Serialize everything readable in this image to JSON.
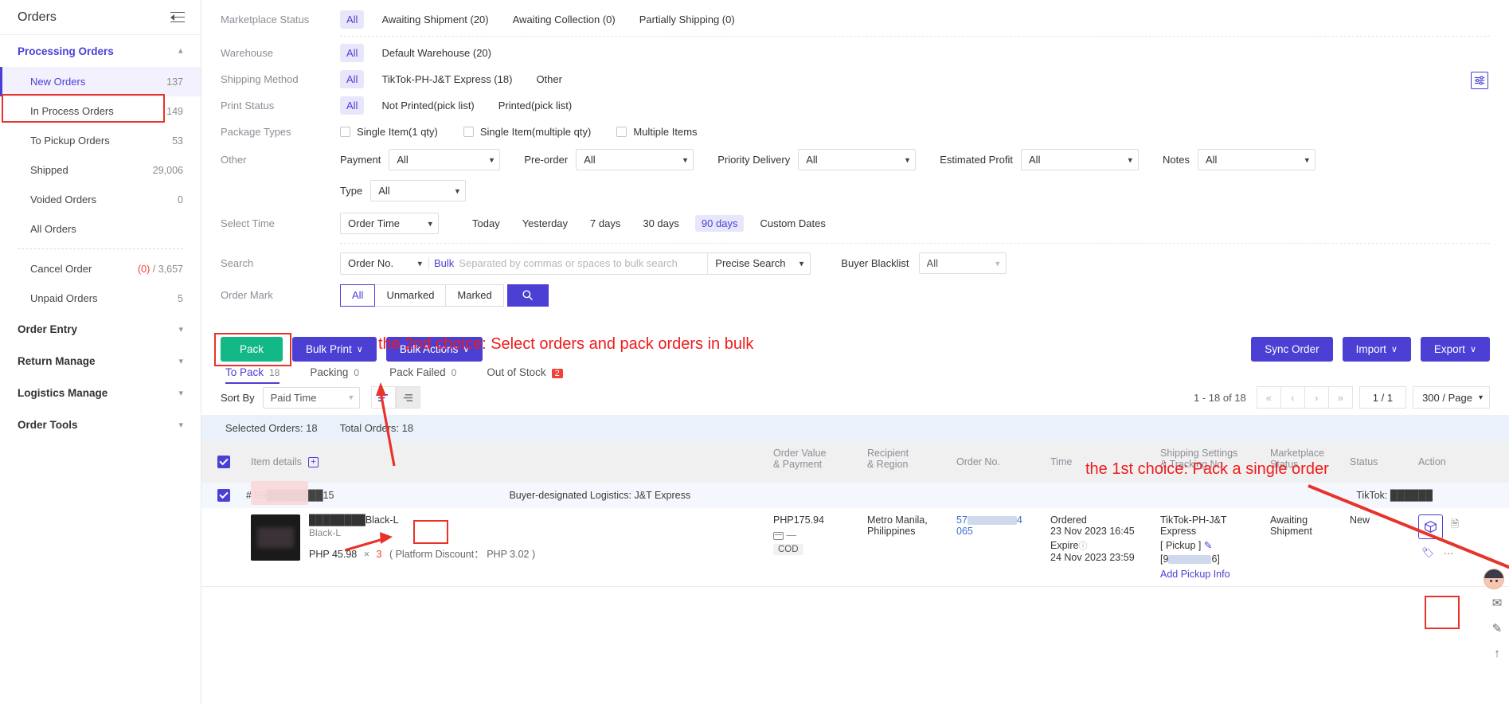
{
  "sidebar": {
    "title": "Orders",
    "collapse_icon": "collapse-icon",
    "groups": [
      {
        "label": "Processing Orders",
        "expanded": true,
        "items": [
          {
            "label": "New Orders",
            "count": "137",
            "active": true
          },
          {
            "label": "In Process Orders",
            "count": "149"
          },
          {
            "label": "To Pickup Orders",
            "count": "53"
          },
          {
            "label": "Shipped",
            "count": "29,006"
          },
          {
            "label": "Voided Orders",
            "count": "0"
          },
          {
            "label": "All Orders",
            "count": ""
          }
        ],
        "items2": [
          {
            "label": "Cancel Order",
            "count_red": "(0)",
            "count": " / 3,657"
          },
          {
            "label": "Unpaid Orders",
            "count": "5"
          }
        ]
      },
      {
        "label": "Order Entry",
        "expanded": false
      },
      {
        "label": "Return Manage",
        "expanded": false
      },
      {
        "label": "Logistics Manage",
        "expanded": false
      },
      {
        "label": "Order Tools",
        "expanded": false
      }
    ]
  },
  "filters": {
    "marketplace_status": {
      "label": "Marketplace Status",
      "options": [
        "All",
        "Awaiting Shipment (20)",
        "Awaiting Collection (0)",
        "Partially Shipping (0)"
      ],
      "selected": "All"
    },
    "warehouse": {
      "label": "Warehouse",
      "options": [
        "All",
        "Default Warehouse (20)"
      ],
      "selected": "All"
    },
    "shipping_method": {
      "label": "Shipping Method",
      "options": [
        "All",
        "TikTok-PH-J&T Express (18)",
        "Other"
      ],
      "selected": "All"
    },
    "print_status": {
      "label": "Print Status",
      "options": [
        "All",
        "Not Printed(pick list)",
        "Printed(pick list)"
      ],
      "selected": "All"
    },
    "package_types": {
      "label": "Package Types",
      "options": [
        "Single Item(1 qty)",
        "Single Item(multiple qty)",
        "Multiple Items"
      ]
    },
    "other": {
      "label": "Other",
      "fields": [
        {
          "label": "Payment",
          "value": "All"
        },
        {
          "label": "Pre-order",
          "value": "All"
        },
        {
          "label": "Priority Delivery",
          "value": "All"
        },
        {
          "label": "Estimated Profit",
          "value": "All"
        },
        {
          "label": "Notes",
          "value": "All"
        }
      ],
      "type_field": {
        "label": "Type",
        "value": "All"
      }
    },
    "select_time": {
      "label": "Select Time",
      "dropdown": "Order Time",
      "buttons": [
        "Today",
        "Yesterday",
        "7 days",
        "30 days",
        "90 days",
        "Custom Dates"
      ],
      "selected": "90 days"
    },
    "search": {
      "label": "Search",
      "field_type": "Order No.",
      "bulk_label": "Bulk",
      "placeholder": "Separated by commas or spaces to bulk search",
      "value": "",
      "match_mode": "Precise Search",
      "blacklist_label": "Buyer Blacklist",
      "blacklist_value": "All"
    },
    "order_mark": {
      "label": "Order Mark",
      "options": [
        "All",
        "Unmarked",
        "Marked"
      ],
      "selected": "All",
      "search_icon": "search-icon"
    },
    "config_icon": "column-config-icon"
  },
  "toolbar": {
    "pack": "Pack",
    "bulk_print": "Bulk Print",
    "bulk_actions": "Bulk Actions",
    "sync_order": "Sync Order",
    "import": "Import",
    "export": "Export",
    "chevron": "∨"
  },
  "tabs": [
    {
      "label": "To Pack",
      "count": "18",
      "active": true
    },
    {
      "label": "Packing",
      "count": "0"
    },
    {
      "label": "Pack Failed",
      "count": "0"
    },
    {
      "label": "Out of Stock",
      "count": "2",
      "badge": true
    }
  ],
  "sortbar": {
    "label": "Sort By",
    "value": "Paid Time",
    "asc_icon": "sort-ascending-icon",
    "desc_icon": "sort-descending-icon",
    "range": "1 - 18 of 18",
    "first": "«",
    "prev": "‹",
    "next": "›",
    "last": "»",
    "page": "1 / 1",
    "page_size": "300 / Page"
  },
  "selection_bar": {
    "selected": "Selected Orders: 18",
    "total": "Total Orders: 18"
  },
  "table": {
    "headers": {
      "item_details": "Item details",
      "expand_icon": "expand-all-icon",
      "order_value": "Order Value\n& Payment",
      "order_value_l1": "Order Value",
      "order_value_l2": "& Payment",
      "recipient_l1": "Recipient",
      "recipient_l2": "& Region",
      "order_no": "Order No.",
      "time": "Time",
      "shipping_l1": "Shipping Settings",
      "shipping_l2": "& Tracking No.",
      "marketplace_l1": "Marketplace",
      "marketplace_l2": "Status",
      "status": "Status",
      "action": "Action"
    },
    "rows": [
      {
        "order_ref": "# B9████████15",
        "logistics": "Buyer-designated Logistics: J&T Express",
        "marketplace_account": "TikTok: ██████",
        "product_name": "████████Black-L",
        "product_meta": "Black-L",
        "unit_price": "PHP 45.98",
        "qty": "3",
        "discount_label": "( Platform Discount：",
        "discount_value": "PHP 3.02 )",
        "order_value": "PHP175.94",
        "payment_icon": "card-icon",
        "payment_dash": "—",
        "payment_tag": "COD",
        "recipient_l1": "Metro Manila,",
        "recipient_l2": "Philippines",
        "order_no_prefix": "57",
        "order_no_suffix": "4",
        "order_no_line2": "065",
        "time_status": "Ordered",
        "time_value": "23 Nov 2023 16:45",
        "expire_label": "Expire",
        "expire_icon": "help-icon",
        "expire_value": "24 Nov 2023 23:59",
        "ship_l1": "TikTok-PH-J&T",
        "ship_l2": "Express",
        "pickup_label": "[ Pickup ]",
        "edit_icon": "edit-icon",
        "tracking": "[9███████6]",
        "add_pickup": "Add Pickup Info",
        "marketplace_l1": "Awaiting",
        "marketplace_l2": "Shipment",
        "status": "New",
        "action_icon": "package-box-icon",
        "action_icons": [
          "note-icon",
          "tag-icon",
          "more-icon"
        ]
      }
    ]
  },
  "annotations": [
    {
      "id": "anno-bulk",
      "text": "the 2nd choice: Select orders and pack orders in bulk"
    },
    {
      "id": "anno-single",
      "text": "the 1st choice: Pack a single order"
    }
  ],
  "rail": {
    "icons": [
      "avatar-icon",
      "message-icon",
      "feedback-icon",
      "scroll-top-icon"
    ]
  },
  "colors": {
    "accent": "#4b3fd4",
    "green": "#12b886",
    "red": "#e8332a",
    "badge_red": "#f04134"
  }
}
